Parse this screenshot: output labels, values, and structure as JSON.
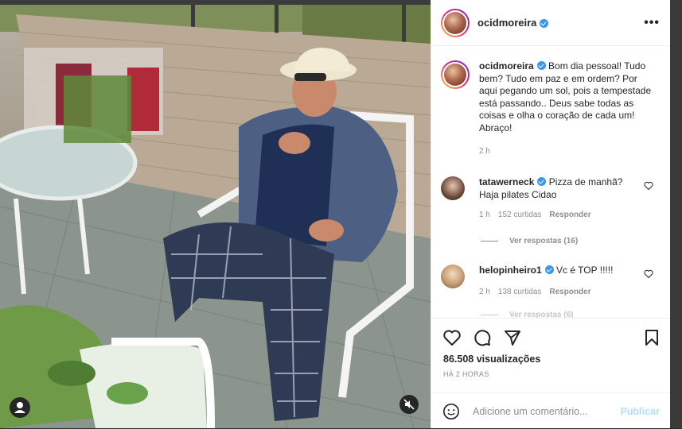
{
  "post": {
    "username": "ocidmoreira",
    "caption": "Bom dia pessoal! Tudo bem? Tudo em paz e em ordem? Por aqui pegando um sol, pois a tempestade está passando.. Deus sabe todas as coisas e olha o coração de cada um! Abraço!",
    "caption_time": "2 h"
  },
  "comments": [
    {
      "username": "tatawerneck",
      "text_line1": "Pizza de manhã?",
      "text_line2": "Haja pilates Cidao",
      "time": "1 h",
      "likes": "152 curtidas",
      "reply": "Responder",
      "view_replies": "Ver respostas (16)"
    },
    {
      "username": "helopinheiro1",
      "text_line1": "Vc é TOP !!!!!",
      "time": "2 h",
      "likes": "138 curtidas",
      "reply": "Responder",
      "view_replies": "Ver respostas (6)"
    }
  ],
  "footer": {
    "views": "86.508 visualizações",
    "ago": "HÁ 2 HORAS",
    "comment_placeholder": "Adicione um comentário...",
    "publish": "Publicar"
  },
  "icons": [
    "more-icon",
    "heart-icon",
    "comment-icon",
    "share-icon",
    "bookmark-icon",
    "emoji-icon",
    "mute-icon",
    "user-tag-icon",
    "verified-icon"
  ],
  "colors": {
    "verified": "#3897f0",
    "publish_disabled": "#b2dffc",
    "muted_text": "#8e8e8e"
  }
}
